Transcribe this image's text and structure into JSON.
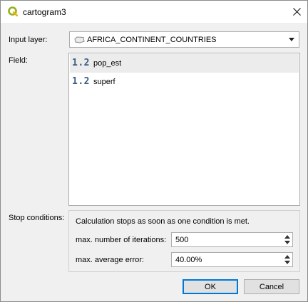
{
  "window": {
    "title": "cartogram3",
    "app_icon": "qgis-logo-icon",
    "close_icon": "close-icon"
  },
  "form": {
    "input_layer_label": "Input layer:",
    "input_layer_value": "AFRICA_CONTINENT_COUNTRIES",
    "input_layer_icon": "polygon-layer-icon",
    "field_label": "Field:",
    "fields": [
      {
        "type_icon": "1.2",
        "name": "pop_est",
        "selected": true
      },
      {
        "type_icon": "1.2",
        "name": "superf",
        "selected": false
      }
    ],
    "stop_conditions_label": "Stop conditions:",
    "stop_note": "Calculation stops as soon as one condition is met.",
    "max_iterations_label": "max. number of iterations:",
    "max_iterations_value": "500",
    "max_error_label": "max. average error:",
    "max_error_value": "40.00%"
  },
  "buttons": {
    "ok": "OK",
    "cancel": "Cancel"
  }
}
